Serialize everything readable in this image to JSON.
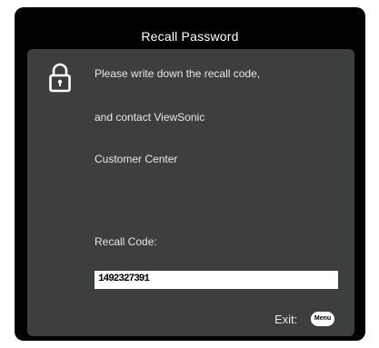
{
  "dialog": {
    "title": "Recall Password",
    "message_line_1": "Please write down the recall code,",
    "message_line_2": "and contact ViewSonic",
    "message_line_3": "Customer Center",
    "recall_code_label": "Recall Code:",
    "recall_code_value": "1492327391",
    "exit_label": "Exit:",
    "menu_button_label": "Menu",
    "lock_icon": "lock-icon"
  },
  "colors": {
    "frame": "#000000",
    "panel": "#3d3f3e",
    "text": "#e6e6e6",
    "code_field": "#ffffff"
  }
}
